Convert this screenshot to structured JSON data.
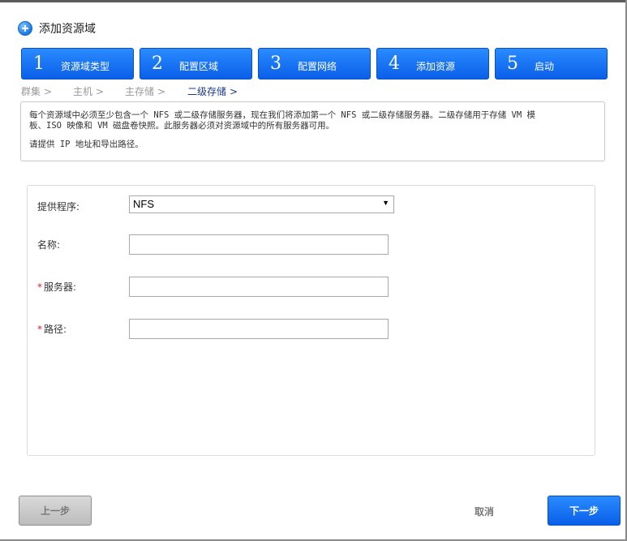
{
  "dialog": {
    "title": "添加资源域"
  },
  "steps": [
    {
      "num": "1",
      "label": "资源域类型"
    },
    {
      "num": "2",
      "label": "配置区域"
    },
    {
      "num": "3",
      "label": "配置网络"
    },
    {
      "num": "4",
      "label": "添加资源"
    },
    {
      "num": "5",
      "label": "启动"
    }
  ],
  "breadcrumb": [
    {
      "label": "群集",
      "sep": ">"
    },
    {
      "label": "主机",
      "sep": ">"
    },
    {
      "label": "主存储",
      "sep": ">"
    },
    {
      "label": "二级存储",
      "sep": ">"
    }
  ],
  "info": {
    "line1": "每个资源域中必须至少包含一个 NFS 或二级存储服务器，现在我们将添加第一个 NFS 或二级存储服务器。二级存储用于存储 VM 模",
    "line2": "板、ISO 映像和 VM 磁盘卷快照。此服务器必须对资源域中的所有服务器可用。",
    "line3": "请提供 IP 地址和导出路径。"
  },
  "form": {
    "provider": {
      "label": "提供程序:",
      "value": "NFS",
      "arrow": "▼"
    },
    "name": {
      "label": "名称:",
      "value": ""
    },
    "server": {
      "required_mark": "*",
      "label": "服务器:",
      "value": ""
    },
    "path": {
      "required_mark": "*",
      "label": "路径:",
      "value": ""
    }
  },
  "buttons": {
    "prev": "上一步",
    "cancel": "取消",
    "next": "下一步"
  },
  "colors": {
    "accent": "#0a5fe8",
    "required": "#d0242c"
  }
}
